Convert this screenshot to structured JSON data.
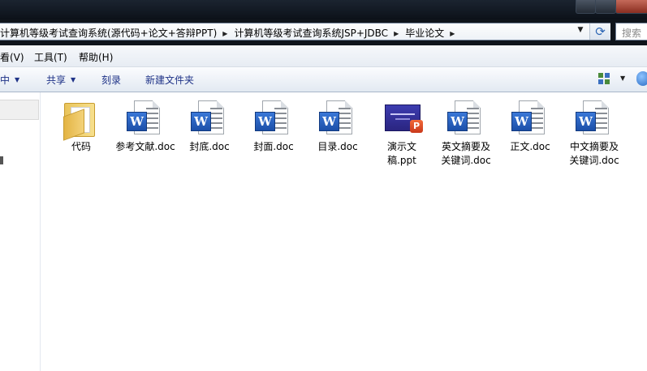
{
  "address_bar": {
    "breadcrumbs": [
      "计算机等级考试查询系统(源代码+论文+答辩PPT)",
      "计算机等级考试查询系统JSP+JDBC",
      "毕业论文"
    ]
  },
  "search": {
    "placeholder": "搜索"
  },
  "menu": {
    "view": "看(V)",
    "tools": "工具(T)",
    "help": "帮助(H)"
  },
  "toolbar": {
    "include_in_library": "中",
    "share": "共享",
    "burn": "刻录",
    "new_folder": "新建文件夹"
  },
  "files": [
    {
      "label": "代码",
      "type": "folder"
    },
    {
      "label": "参考文献.doc",
      "type": "word"
    },
    {
      "label": "封底.doc",
      "type": "word"
    },
    {
      "label": "封面.doc",
      "type": "word"
    },
    {
      "label": "目录.doc",
      "type": "word"
    },
    {
      "label": "演示文稿.ppt",
      "type": "powerpoint"
    },
    {
      "label": "英文摘要及关键词.doc",
      "type": "word"
    },
    {
      "label": "正文.doc",
      "type": "word"
    },
    {
      "label": "中文摘要及关键词.doc",
      "type": "word"
    }
  ]
}
